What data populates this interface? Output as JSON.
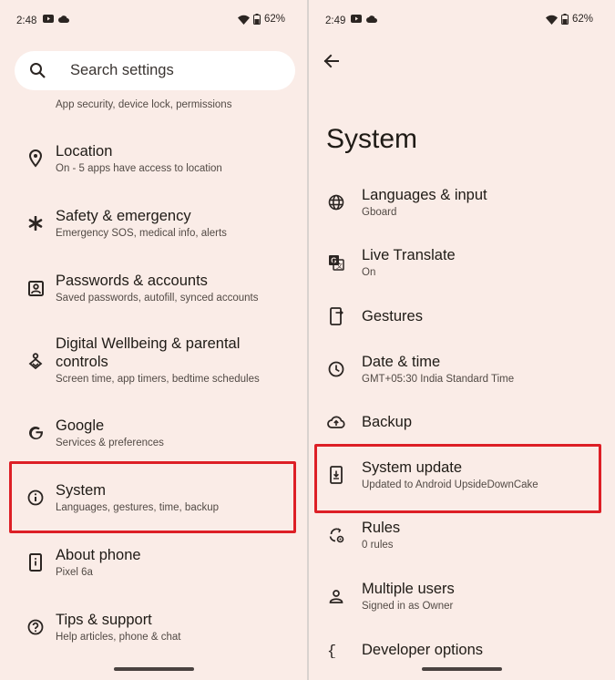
{
  "left": {
    "status": {
      "time": "2:48",
      "battery": "62%"
    },
    "search": {
      "placeholder": "Search settings"
    },
    "partial_item_sub": "App security, device lock, permissions",
    "items": [
      {
        "title": "Location",
        "sub": "On - 5 apps have access to location",
        "icon": "location-pin-icon"
      },
      {
        "title": "Safety & emergency",
        "sub": "Emergency SOS, medical info, alerts",
        "icon": "asterisk-icon"
      },
      {
        "title": "Passwords & accounts",
        "sub": "Saved passwords, autofill, synced accounts",
        "icon": "account-box-icon"
      },
      {
        "title_line1": "Digital Wellbeing & parental",
        "title_line2": "controls",
        "sub": "Screen time, app timers, bedtime schedules",
        "icon": "wellbeing-icon"
      },
      {
        "title": "Google",
        "sub": "Services & preferences",
        "icon": "google-g-icon"
      },
      {
        "title": "System",
        "sub": "Languages, gestures, time, backup",
        "icon": "info-icon"
      },
      {
        "title": "About phone",
        "sub": "Pixel 6a",
        "icon": "phone-info-icon"
      },
      {
        "title": "Tips & support",
        "sub": "Help articles, phone & chat",
        "icon": "help-icon"
      }
    ]
  },
  "right": {
    "status": {
      "time": "2:49",
      "battery": "62%"
    },
    "page_title": "System",
    "items": [
      {
        "title": "Languages & input",
        "sub": "Gboard",
        "icon": "globe-icon"
      },
      {
        "title": "Live Translate",
        "sub": "On",
        "icon": "translate-icon"
      },
      {
        "title": "Gestures",
        "icon": "gesture-phone-icon"
      },
      {
        "title": "Date & time",
        "sub": "GMT+05:30 India Standard Time",
        "icon": "clock-icon"
      },
      {
        "title": "Backup",
        "icon": "cloud-upload-icon"
      },
      {
        "title": "System update",
        "sub": "Updated to Android UpsideDownCake",
        "icon": "system-update-icon"
      },
      {
        "title": "Rules",
        "sub": "0 rules",
        "icon": "rules-icon"
      },
      {
        "title": "Multiple users",
        "sub": "Signed in as Owner",
        "icon": "person-icon"
      },
      {
        "title": "Developer options",
        "icon": "braces-icon"
      }
    ]
  },
  "colors": {
    "background": "#faece7",
    "highlight": "#dd1f26",
    "text": "#1f1b16",
    "subtext": "#524a45"
  }
}
